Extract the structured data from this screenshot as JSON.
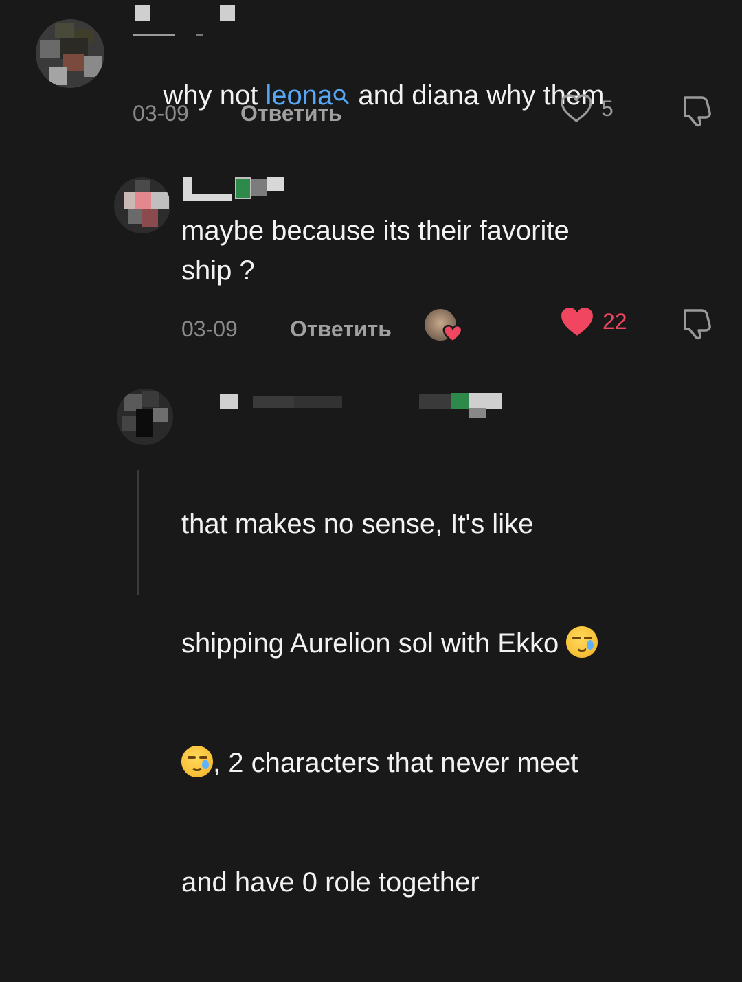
{
  "comments": [
    {
      "text_before": "why not ",
      "mention": "leona",
      "text_after": " and diana why them",
      "date": "03-09",
      "reply_label": "Ответить",
      "like_count": "5",
      "liked": false
    },
    {
      "text": "maybe because its their favorite\nship ?",
      "date": "03-09",
      "reply_label": "Ответить",
      "like_count": "22",
      "liked": true,
      "creator_liked": true
    },
    {
      "text_line1": "that makes no sense, It's like",
      "text_line2": "shipping Aurelion sol with Ekko ",
      "text_line3": ", 2 characters that never meet",
      "text_line4": "and have 0 role together"
    }
  ],
  "icons": {
    "like": "heart-outline-icon",
    "liked": "heart-filled-icon",
    "dislike": "thumbs-down-icon",
    "mention_search": "search-icon",
    "emoji": "crying-smile-emoji"
  },
  "colors": {
    "background": "#191919",
    "mention": "#57a7f5",
    "liked": "#f0465f",
    "muted": "#8a8a8a"
  }
}
